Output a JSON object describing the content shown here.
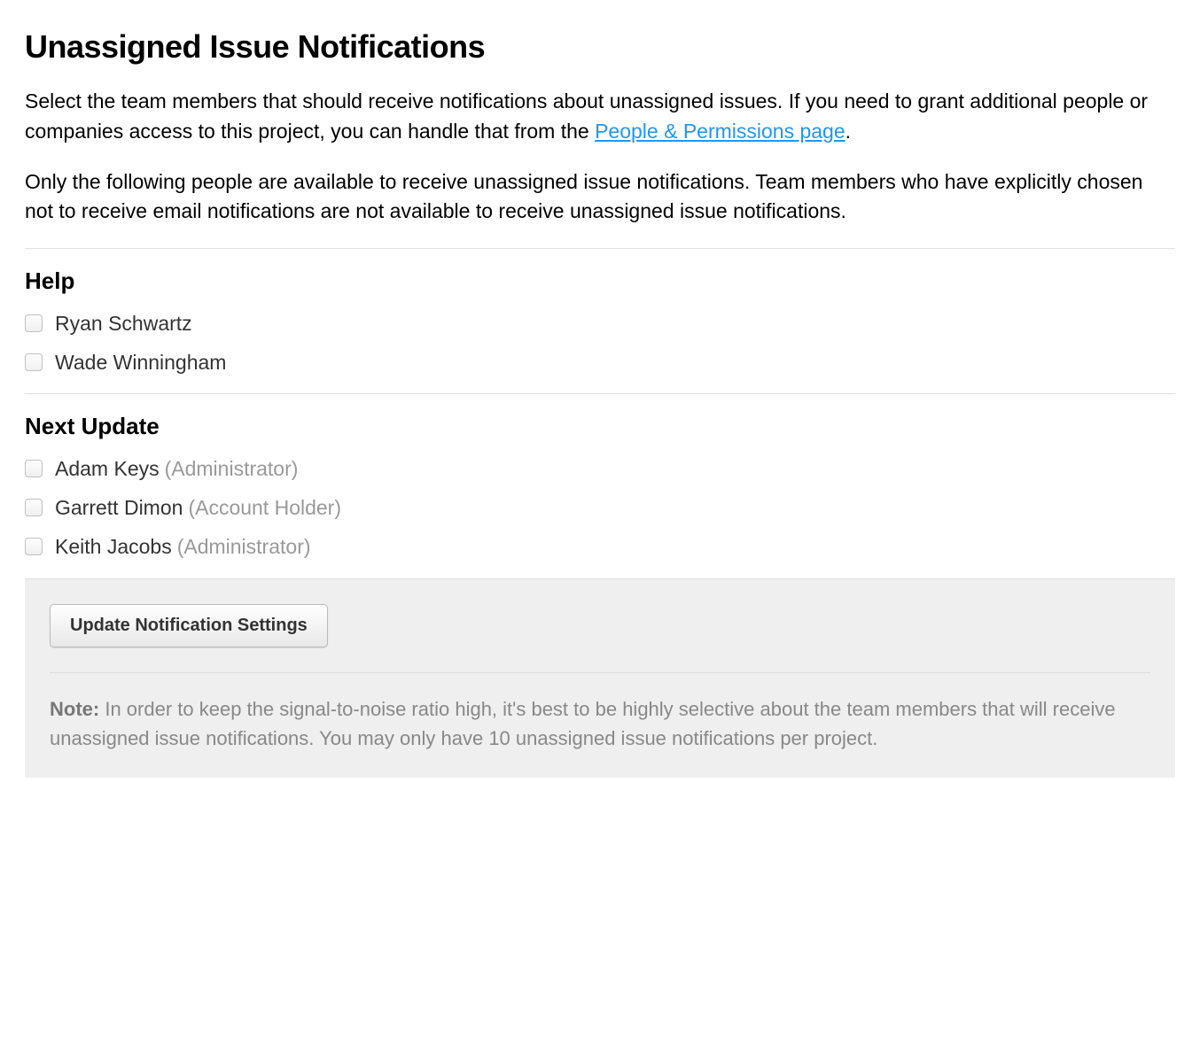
{
  "header": {
    "title": "Unassigned Issue Notifications"
  },
  "intro": {
    "text1_prefix": "Select the team members that should receive notifications about unassigned issues. If you need to grant additional people or companies access to this project, you can handle that from the ",
    "link_text": "People & Permissions page",
    "text1_suffix": ".",
    "text2": "Only the following people are available to receive unassigned issue notifications. Team members who have explicitly chosen not to receive email notifications are not available to receive unassigned issue notifications."
  },
  "sections": [
    {
      "title": "Help",
      "people": [
        {
          "name": "Ryan Schwartz",
          "role": ""
        },
        {
          "name": "Wade Winningham",
          "role": ""
        }
      ]
    },
    {
      "title": "Next Update",
      "people": [
        {
          "name": "Adam Keys",
          "role": "(Administrator)"
        },
        {
          "name": "Garrett Dimon",
          "role": "(Account Holder)"
        },
        {
          "name": "Keith Jacobs",
          "role": "(Administrator)"
        }
      ]
    }
  ],
  "footer": {
    "button_label": "Update Notification Settings",
    "note_label": "Note:",
    "note_text": " In order to keep the signal-to-noise ratio high, it's best to be highly selective about the team members that will receive unassigned issue notifications. You may only have 10 unassigned issue notifications per project."
  }
}
